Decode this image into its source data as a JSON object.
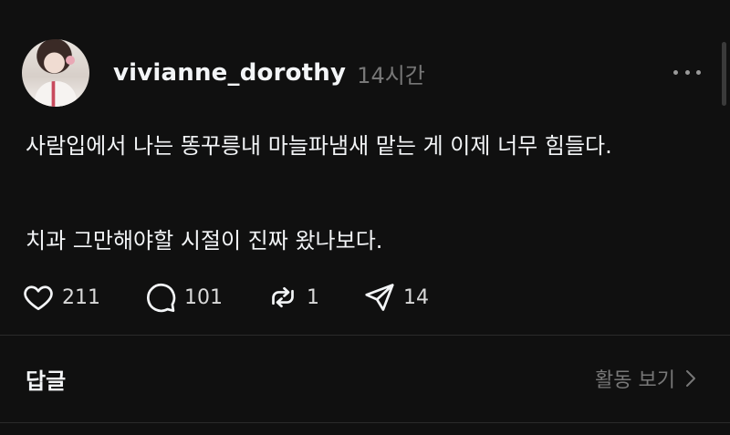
{
  "post": {
    "username": "vivianne_dorothy",
    "time": "14시간",
    "text_line1": "사람입에서 나는 똥꾸릉내 마늘파냄새 맡는 게 이제 너무 힘들다.",
    "text_line2": "치과 그만해야할 시절이 진짜 왔나보다."
  },
  "actions": {
    "likes": "211",
    "comments": "101",
    "reposts": "1",
    "shares": "14"
  },
  "replies": {
    "title": "답글",
    "view_activity": "활동 보기"
  },
  "icons": {
    "like": "heart-icon",
    "comment": "comment-bubble-icon",
    "repost": "repost-icon",
    "share": "send-icon",
    "more": "more-dots-icon",
    "chevron": "chevron-right-icon"
  },
  "colors": {
    "background": "#101010",
    "text": "#f3f5f7",
    "muted": "#777777"
  }
}
